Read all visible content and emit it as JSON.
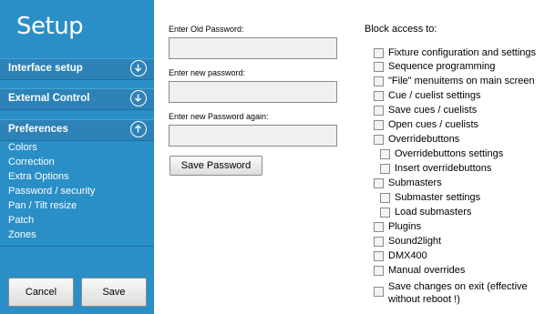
{
  "sidebar": {
    "title": "Setup",
    "sections": [
      {
        "label": "Interface setup",
        "icon": "chevron-down-circle-icon"
      },
      {
        "label": "External Control",
        "icon": "chevron-down-circle-icon"
      },
      {
        "label": "Preferences",
        "icon": "chevron-up-circle-icon"
      }
    ],
    "preferences_items": [
      "Colors",
      "Correction",
      "Extra Options",
      "Password / security",
      "Pan / Tilt resize",
      "Patch",
      "Zones"
    ],
    "cancel_label": "Cancel",
    "save_label": "Save"
  },
  "password": {
    "old_label": "Enter Old Password:",
    "old_value": "",
    "new_label": "Enter new password:",
    "new_value": "",
    "again_label": "Enter new Password again:",
    "again_value": "",
    "save_button": "Save Password"
  },
  "block_access": {
    "title": "Block access to:",
    "items": [
      {
        "label": "Fixture configuration and settings",
        "checked": false
      },
      {
        "label": "Sequence programming",
        "checked": false
      },
      {
        "label": "\"File\" menuitems on main screen",
        "checked": false
      },
      {
        "label": "Cue / cuelist settings",
        "checked": false
      },
      {
        "label": "Save cues / cuelists",
        "checked": false
      },
      {
        "label": "Open cues / cuelists",
        "checked": false
      },
      {
        "label": "Overridebuttons",
        "checked": false
      },
      {
        "label": "Overridebuttons settings",
        "checked": false
      },
      {
        "label": "Insert overridebuttons",
        "checked": false
      },
      {
        "label": "Submasters",
        "checked": false
      },
      {
        "label": "Submaster settings",
        "checked": false
      },
      {
        "label": "Load submasters",
        "checked": false
      },
      {
        "label": "Plugins",
        "checked": false
      },
      {
        "label": "Sound2light",
        "checked": false
      },
      {
        "label": "DMX400",
        "checked": false
      },
      {
        "label": "Manual overrides",
        "checked": false
      },
      {
        "label": "Save changes on exit (effective",
        "label_line2": "without reboot !)",
        "checked": false
      }
    ]
  },
  "colors": {
    "sidebar_bg": "#2a8fc6",
    "section_bg": "#2d82b8",
    "text_light": "#ffffff"
  }
}
